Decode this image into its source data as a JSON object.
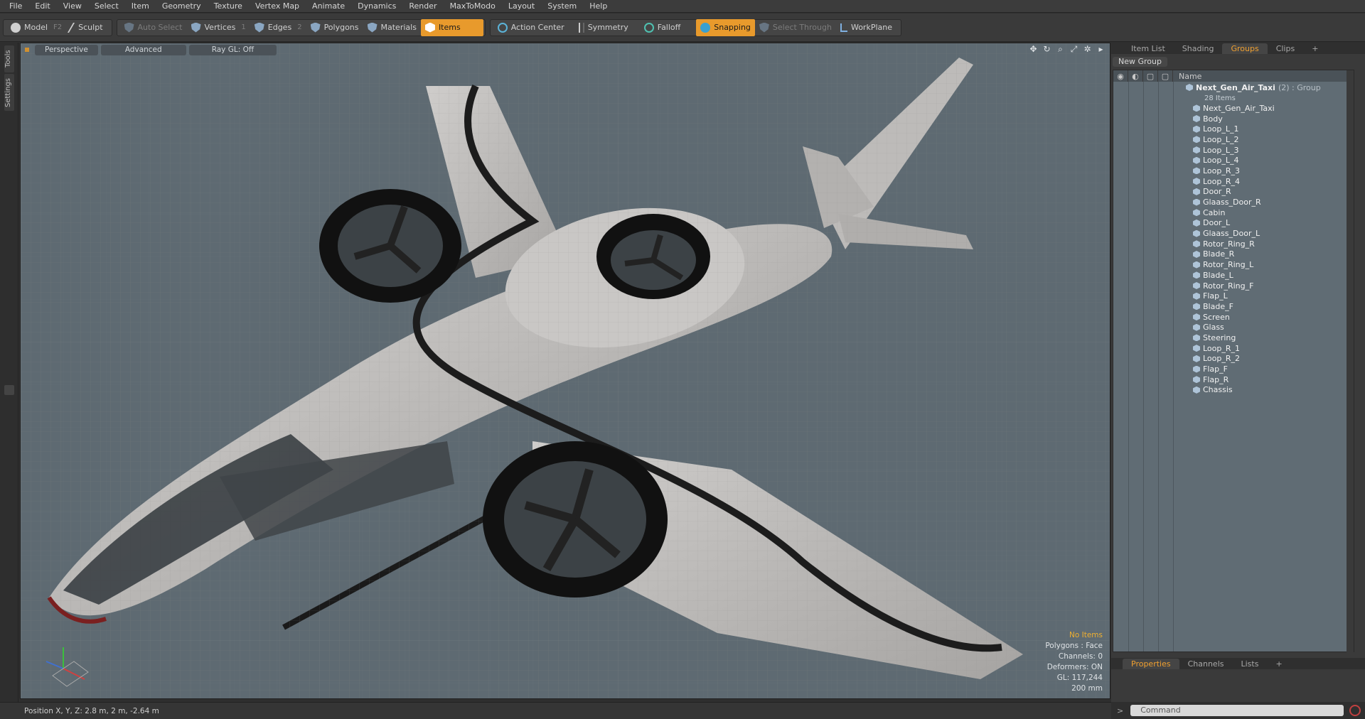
{
  "menu": [
    "File",
    "Edit",
    "View",
    "Select",
    "Item",
    "Geometry",
    "Texture",
    "Vertex Map",
    "Animate",
    "Dynamics",
    "Render",
    "MaxToModo",
    "Layout",
    "System",
    "Help"
  ],
  "toolbar": {
    "model": "Model",
    "model_key": "F2",
    "sculpt": "Sculpt",
    "auto_select": "Auto Select",
    "vertices": "Vertices",
    "vertices_key": "1",
    "edges": "Edges",
    "edges_key": "2",
    "polygons": "Polygons",
    "materials": "Materials",
    "items": "Items",
    "action_center": "Action Center",
    "symmetry": "Symmetry",
    "falloff": "Falloff",
    "snapping": "Snapping",
    "select_through": "Select Through",
    "workplane": "WorkPlane"
  },
  "left_tabs": [
    "Tools",
    "Settings"
  ],
  "viewport": {
    "view": "Perspective",
    "advanced": "Advanced",
    "raygl": "Ray GL: Off",
    "info": {
      "selection": "No Items",
      "polygons": "Polygons : Face",
      "channels": "Channels: 0",
      "deformers": "Deformers: ON",
      "gl": "GL: 117,244",
      "scale": "200 mm"
    }
  },
  "right_panel": {
    "tabs": [
      "Item List",
      "Shading",
      "Groups",
      "Clips"
    ],
    "active_tab": "Groups",
    "new_group": "New Group",
    "name_header": "Name",
    "group": {
      "name": "Next_Gen_Air_Taxi",
      "suffix": "(2) : Group",
      "count": "28 Items"
    },
    "items": [
      "Next_Gen_Air_Taxi",
      "Body",
      "Loop_L_1",
      "Loop_L_2",
      "Loop_L_3",
      "Loop_L_4",
      "Loop_R_3",
      "Loop_R_4",
      "Door_R",
      "Glaass_Door_R",
      "Cabin",
      "Door_L",
      "Glaass_Door_L",
      "Rotor_Ring_R",
      "Blade_R",
      "Rotor_Ring_L",
      "Blade_L",
      "Rotor_Ring_F",
      "Flap_L",
      "Blade_F",
      "Screen",
      "Glass",
      "Steering",
      "Loop_R_1",
      "Loop_R_2",
      "Flap_F",
      "Flap_R",
      "Chassis"
    ],
    "bottom_tabs": [
      "Properties",
      "Channels",
      "Lists"
    ],
    "command_placeholder": "Command"
  },
  "status": {
    "position": "Position X, Y, Z:   2.8 m, 2 m, -2.64 m"
  }
}
